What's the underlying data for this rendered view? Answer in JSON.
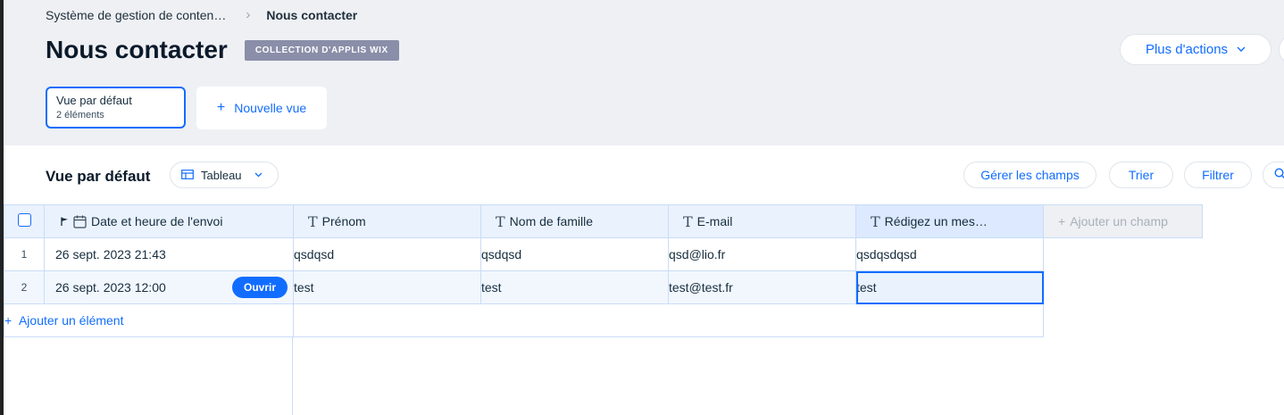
{
  "breadcrumb": {
    "parent": "Système de gestion de conten…",
    "current": "Nous contacter"
  },
  "header": {
    "title": "Nous contacter",
    "badge": "COLLECTION D'APPLIS WIX",
    "more_actions": "Plus d'actions"
  },
  "views": {
    "active": {
      "name": "Vue par défaut",
      "count": "2 éléments"
    },
    "new_view": "Nouvelle vue"
  },
  "panel": {
    "title": "Vue par défaut",
    "layout": "Tableau",
    "toolbar": {
      "manage_fields": "Gérer les champs",
      "sort": "Trier",
      "filter": "Filtrer"
    }
  },
  "table": {
    "columns": [
      "Date et heure de l'envoi",
      "Prénom",
      "Nom de famille",
      "E-mail",
      "Rédigez un mes…"
    ],
    "add_field": "Ajouter un champ",
    "rows": [
      {
        "num": "1",
        "date": "26 sept. 2023 21:43",
        "first": "qsdqsd",
        "last": "qsdqsd",
        "email": "qsd@lio.fr",
        "message": "qsdqsdqsd"
      },
      {
        "num": "2",
        "date": "26 sept. 2023 12:00",
        "first": "test",
        "last": "test",
        "email": "test@test.fr",
        "message": "test"
      }
    ],
    "open_label": "Ouvrir",
    "add_row": "Ajouter un élément"
  },
  "colors": {
    "accent": "#116dff",
    "badge": "#8a8ea8",
    "header_bg": "#eaf2fe"
  }
}
